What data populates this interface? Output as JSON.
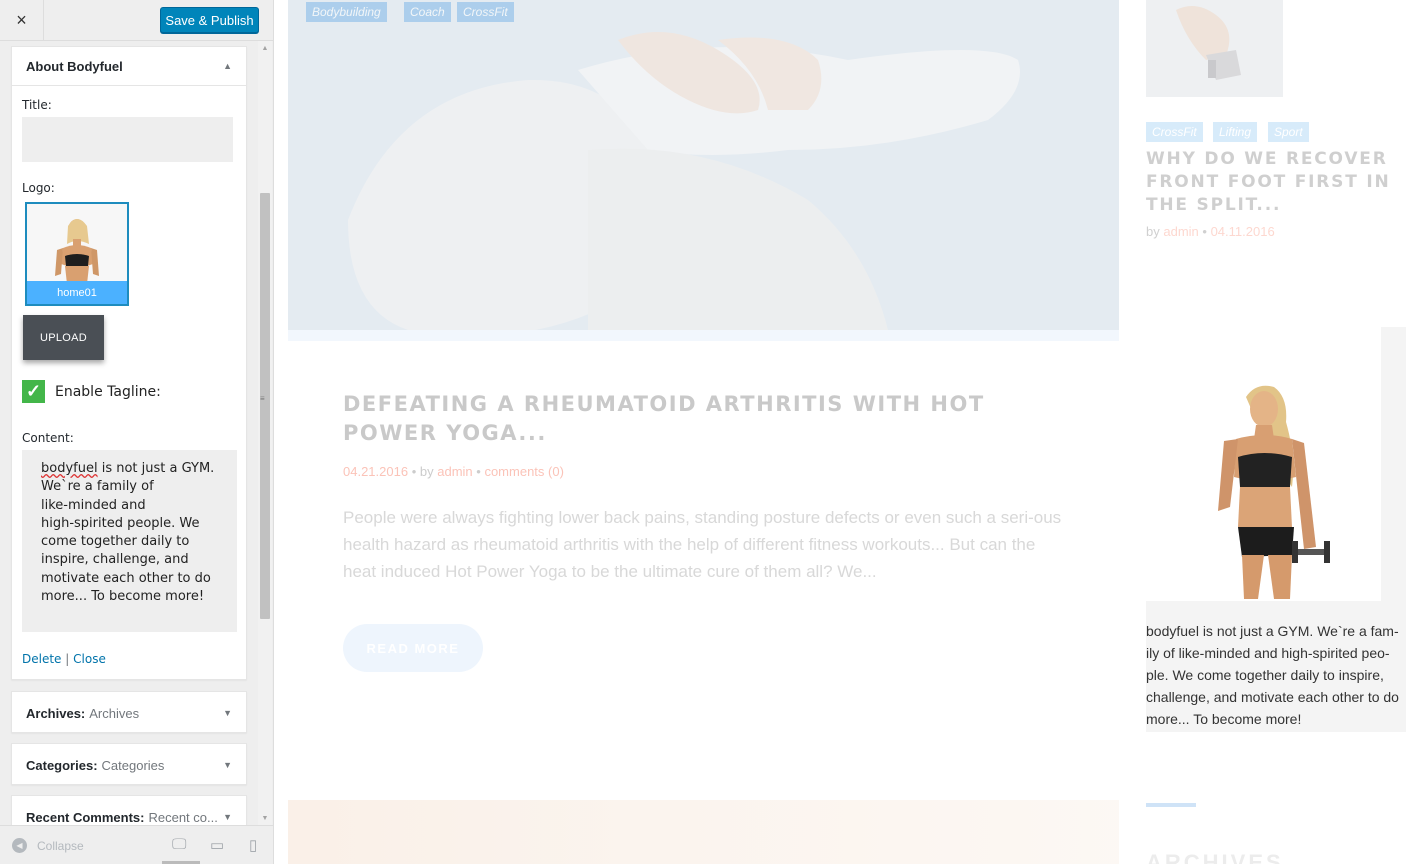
{
  "customizer": {
    "close_icon": "×",
    "publish_label": "Save & Publish",
    "widget": {
      "title": "About Bodyfuel",
      "title_label": "Title:",
      "title_value": "",
      "logo_label": "Logo:",
      "logo_caption": "home01",
      "upload_label": "UPLOAD",
      "tagline_label": "Enable Tagline:",
      "tagline_checked": true,
      "content_label": "Content:",
      "content_first_word": "bodyfuel",
      "content_rest": " is not just a GYM.\nWe`re a family of\nlike-minded and\nhigh-spirited people. We\ncome together daily to\ninspire, challenge, and\nmotivate each other to do\nmore... To become more!",
      "delete_label": "Delete",
      "separator": "|",
      "close_label": "Close"
    },
    "collapsed_widgets": [
      {
        "name": "Archives:",
        "value": "Archives"
      },
      {
        "name": "Categories:",
        "value": "Categories"
      },
      {
        "name": "Recent Comments:",
        "value": "Recent co..."
      }
    ],
    "footer": {
      "collapse_label": "Collapse",
      "devices": [
        "desktop-icon",
        "tablet-icon",
        "mobile-icon"
      ]
    },
    "accent_color": "#0085ba"
  },
  "preview": {
    "hero_tags": [
      "Bodybuilding",
      "Coach",
      "CrossFit"
    ],
    "post": {
      "title": "DEFEATING A RHEUMATOID ARTHRITIS WITH HOT POWER YOGA...",
      "date": "04.21.2016",
      "by": "by",
      "author": "admin",
      "comments": "comments (0)",
      "excerpt": "People were always fighting lower back pains, standing posture defects or even such a seri-ous health hazard as rheumatoid arthritis with the help of different fitness workouts... But can the heat induced Hot Power Yoga to be the ultimate cure of them all? We...",
      "read_more": "READ MORE"
    },
    "side_post": {
      "tags": [
        "CrossFit",
        "Lifting",
        "Sport"
      ],
      "title": "WHY DO WE RECOVER FRONT FOOT FIRST IN THE SPLIT...",
      "by": "by",
      "author": "admin",
      "date": "04.11.2016"
    },
    "about_text": "bodyfuel is not just a GYM. We`re a fam-ily of like-minded and high-spirited peo-ple. We come together daily to inspire, challenge, and motivate each other to do more... To become more!",
    "archives_heading": "ARCHIVES"
  }
}
